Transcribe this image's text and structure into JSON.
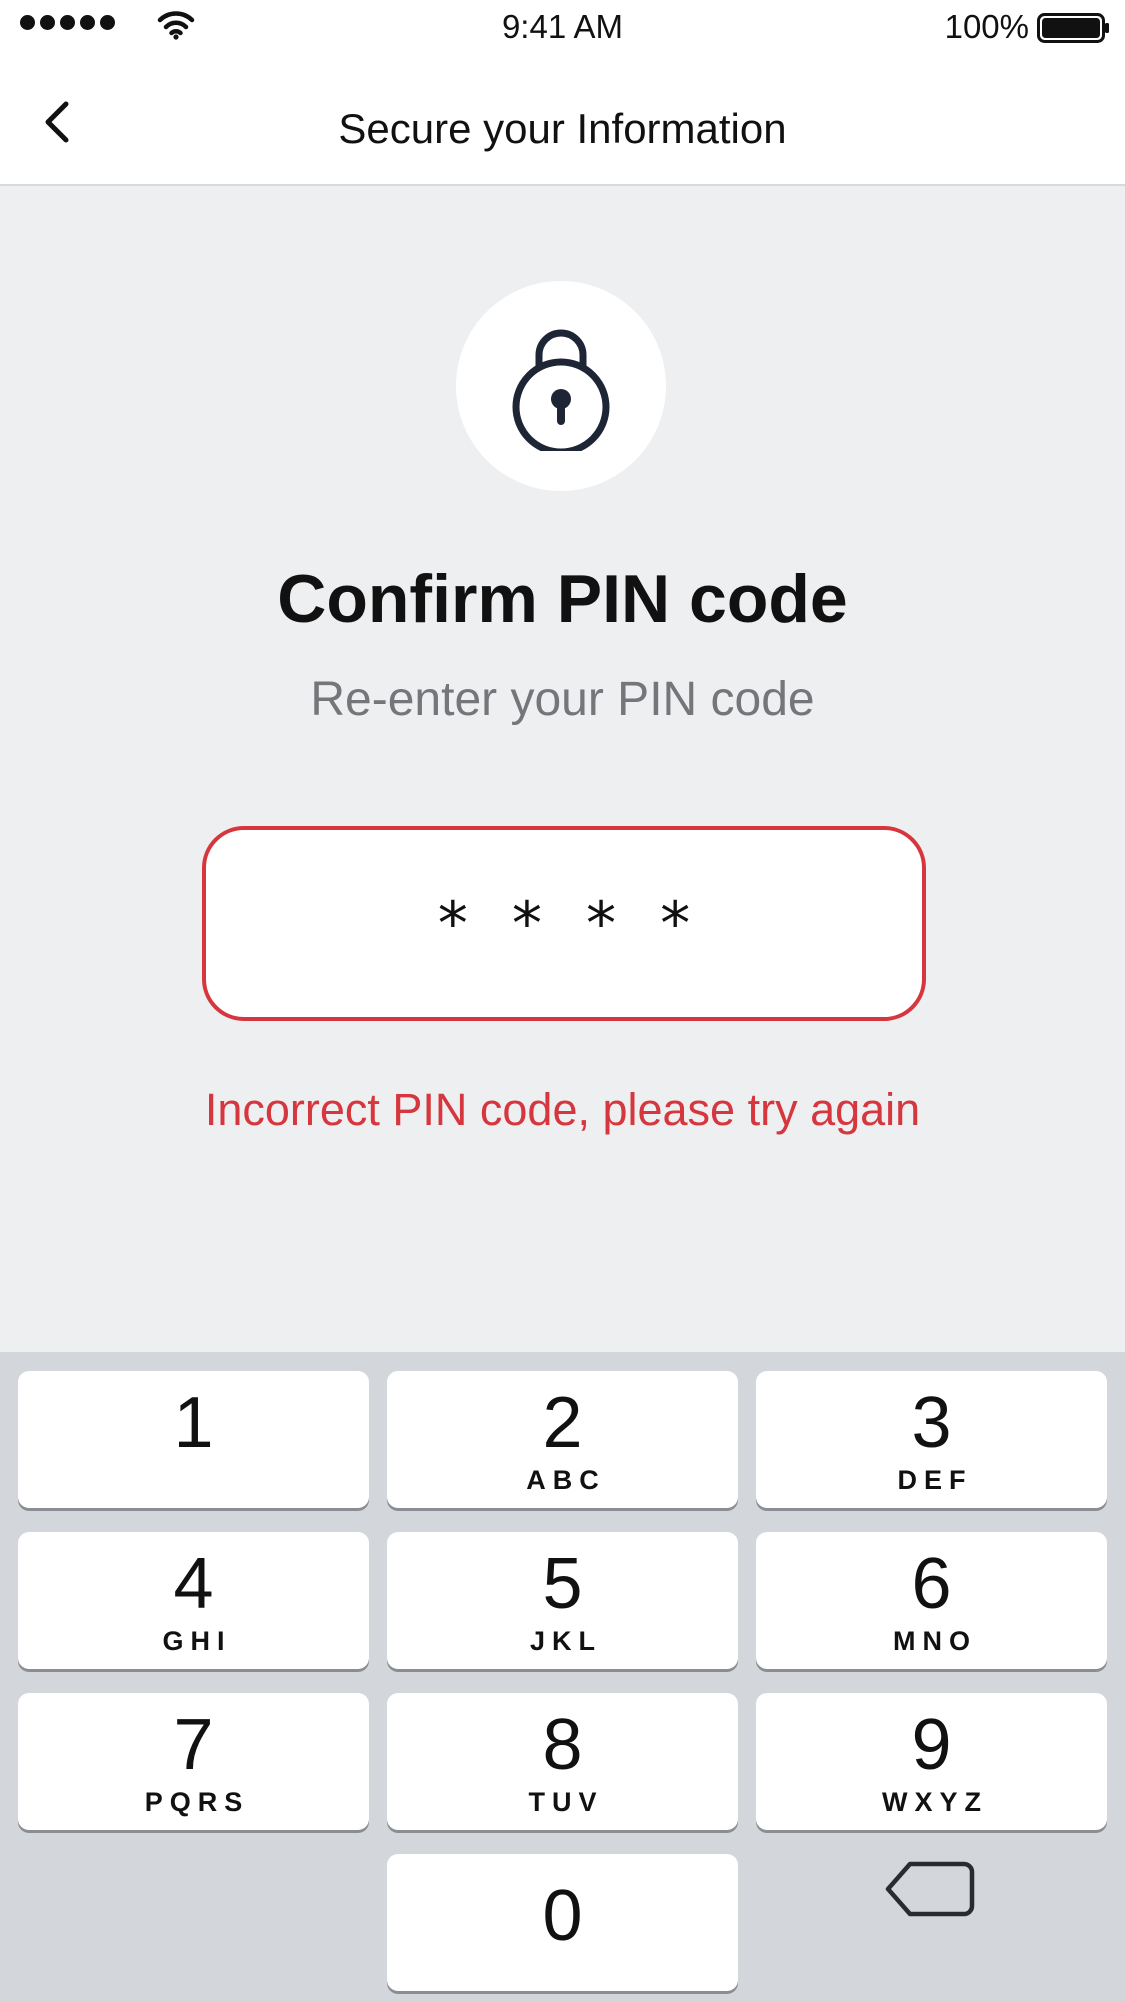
{
  "status_bar": {
    "time": "9:41 AM",
    "battery_percent": "100%",
    "battery_level": 1.0,
    "signal_icon": "cellular-signal-icon",
    "wifi_icon": "wifi-icon",
    "battery_icon": "battery-icon"
  },
  "nav": {
    "title": "Secure your Information",
    "back_icon": "chevron-left-icon"
  },
  "lock_icon": "padlock-icon",
  "heading": "Confirm PIN code",
  "subheading": "Re-enter your PIN code",
  "pin": {
    "masked_value": "****"
  },
  "error_message": "Incorrect PIN code, please try again",
  "colors": {
    "error_red": "#d6363d",
    "background": "#eeeff1",
    "keyboard_background": "#d3d6db",
    "lock_navy": "#1e2535"
  },
  "keypad": {
    "keys": [
      {
        "digit": "1",
        "letters": ""
      },
      {
        "digit": "2",
        "letters": "ABC"
      },
      {
        "digit": "3",
        "letters": "DEF"
      },
      {
        "digit": "4",
        "letters": "GHI"
      },
      {
        "digit": "5",
        "letters": "JKL"
      },
      {
        "digit": "6",
        "letters": "MNO"
      },
      {
        "digit": "7",
        "letters": "PQRS"
      },
      {
        "digit": "8",
        "letters": "TUV"
      },
      {
        "digit": "9",
        "letters": "WXYZ"
      },
      {
        "digit": "0",
        "letters": ""
      }
    ],
    "delete_icon": "backspace-icon"
  }
}
